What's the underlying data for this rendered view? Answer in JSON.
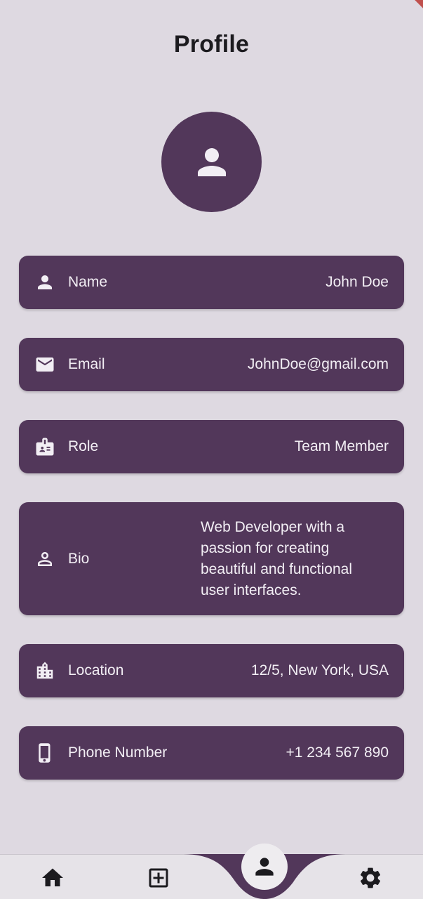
{
  "header": {
    "title": "Profile"
  },
  "avatar": {
    "icon": "person-icon"
  },
  "fields": [
    {
      "icon": "person-icon",
      "label": "Name",
      "value": "John Doe"
    },
    {
      "icon": "email-icon",
      "label": "Email",
      "value": "JohnDoe@gmail.com"
    },
    {
      "icon": "badge-icon",
      "label": "Role",
      "value": "Team Member"
    },
    {
      "icon": "person-outline-icon",
      "label": "Bio",
      "value": "Web Developer with a passion for creating beautiful and functional user interfaces."
    },
    {
      "icon": "building-icon",
      "label": "Location",
      "value": "12/5, New York, USA"
    },
    {
      "icon": "phone-icon",
      "label": "Phone Number",
      "value": "+1 234 567 890"
    }
  ],
  "bottom_nav": {
    "items": [
      {
        "icon": "home-icon"
      },
      {
        "icon": "add-box-icon"
      },
      {
        "icon": "person-icon",
        "selected": true
      },
      {
        "icon": "settings-icon"
      }
    ]
  },
  "colors": {
    "background": "#ded9e1",
    "card": "#52375a",
    "card_text": "#f2eef4",
    "title": "#1c1b1f"
  }
}
